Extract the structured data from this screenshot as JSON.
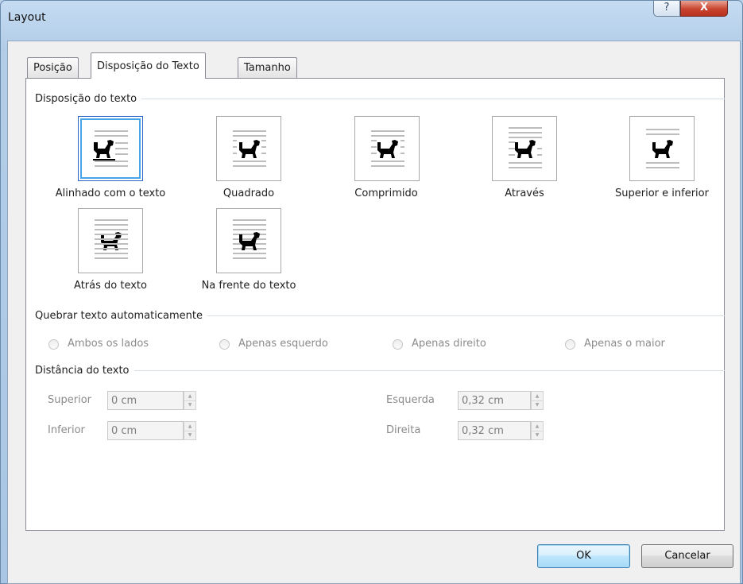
{
  "window": {
    "title": "Layout",
    "help_label": "?",
    "close_label": "X"
  },
  "tabs": [
    {
      "label": "Posição",
      "active": false
    },
    {
      "label": "Disposição do Texto",
      "active": true
    },
    {
      "label": "Tamanho",
      "active": false
    }
  ],
  "wrap_group": {
    "label": "Disposição do texto",
    "options": [
      {
        "label": "Alinhado com o texto",
        "selected": true,
        "icon": "inline-with-text-icon"
      },
      {
        "label": "Quadrado",
        "selected": false,
        "icon": "square-wrap-icon"
      },
      {
        "label": "Comprimido",
        "selected": false,
        "icon": "tight-wrap-icon"
      },
      {
        "label": "Através",
        "selected": false,
        "icon": "through-wrap-icon"
      },
      {
        "label": "Superior e inferior",
        "selected": false,
        "icon": "top-bottom-wrap-icon"
      },
      {
        "label": "Atrás do texto",
        "selected": false,
        "icon": "behind-text-icon"
      },
      {
        "label": "Na frente do texto",
        "selected": false,
        "icon": "in-front-of-text-icon"
      }
    ]
  },
  "auto_wrap_group": {
    "label": "Quebrar texto automaticamente",
    "options": [
      "Ambos os lados",
      "Apenas esquerdo",
      "Apenas direito",
      "Apenas o maior"
    ]
  },
  "distance_group": {
    "label": "Distância do texto",
    "top_label": "Superior",
    "top_value": "0 cm",
    "bottom_label": "Inferior",
    "bottom_value": "0 cm",
    "left_label": "Esquerda",
    "left_value": "0,32 cm",
    "right_label": "Direita",
    "right_value": "0,32 cm"
  },
  "buttons": {
    "ok": "OK",
    "cancel": "Cancelar"
  },
  "colors": {
    "accent": "#3c7fb1",
    "selection": "#47a6e8",
    "disabled_text": "#8b8b8b"
  }
}
